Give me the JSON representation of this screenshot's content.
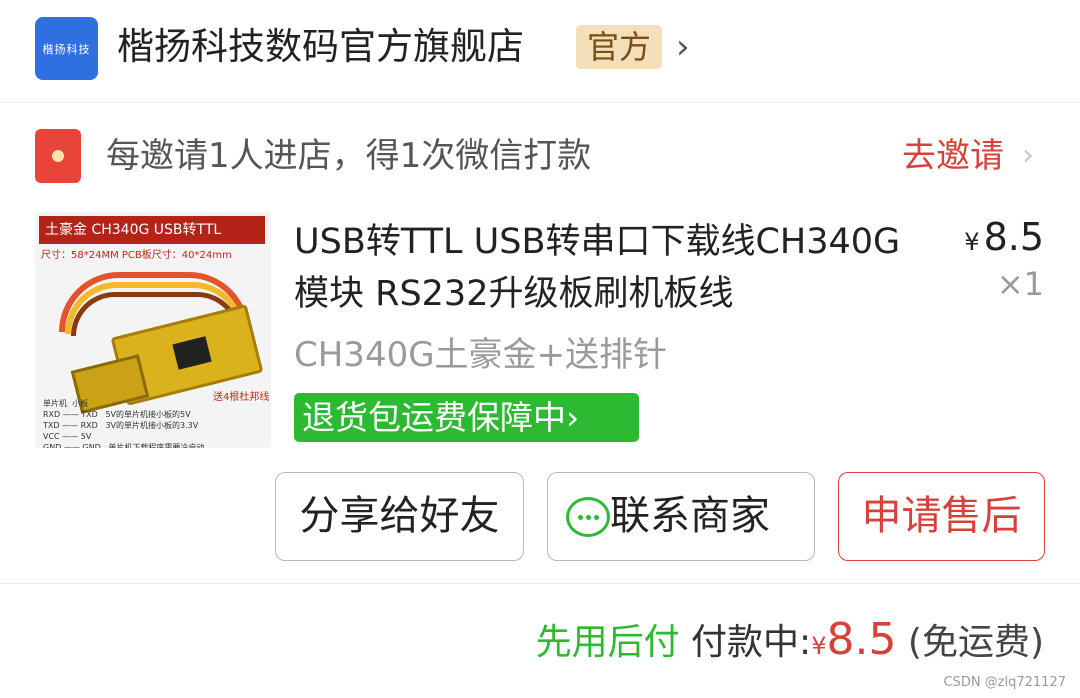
{
  "store": {
    "logo_text": "楷扬科技",
    "name": "楷扬科技数码官方旗舰店",
    "badge": "官方",
    "chevron": "›"
  },
  "invite": {
    "icon": "red-envelope-icon",
    "text": "每邀请1人进店，得1次微信打款",
    "action": "去邀请",
    "chevron": "›"
  },
  "product": {
    "thumbnail": {
      "banner": "土豪金 CH340G USB转TTL",
      "size_line": "尺寸：58*24MM   PCB板尺寸：40*24mm",
      "bottom_text": "单片机  小板\nRXD —— TXD   5V的单片机接小板的5V\nTXD —— RXD   3V的单片机接小板的3.3V\nVCC —— 5V\nGND —— GND   单片机下载程序需要冷启动",
      "send_text": "送4根杜邦线"
    },
    "title": "USB转TTL USB转串口下载线CH340G模块 RS232升级板刷机板线",
    "price_symbol": "¥",
    "price": "8.5",
    "quantity": "×1",
    "spec": "CH340G土豪金+送排针",
    "tag": "退货包运费保障中›"
  },
  "actions": {
    "share": "分享给好友",
    "contact": "联系商家",
    "after_sale": "申请售后"
  },
  "payment": {
    "method": "先用后付",
    "status": "付款中:",
    "currency": "¥",
    "amount": "8.5",
    "shipping": "(免运费)"
  },
  "watermark": "CSDN @zlq721127",
  "colors": {
    "accent_red": "#d8413a",
    "accent_green": "#2dba33",
    "logo_blue": "#2f6fe0",
    "badge_gold": "#f3dfb8"
  }
}
